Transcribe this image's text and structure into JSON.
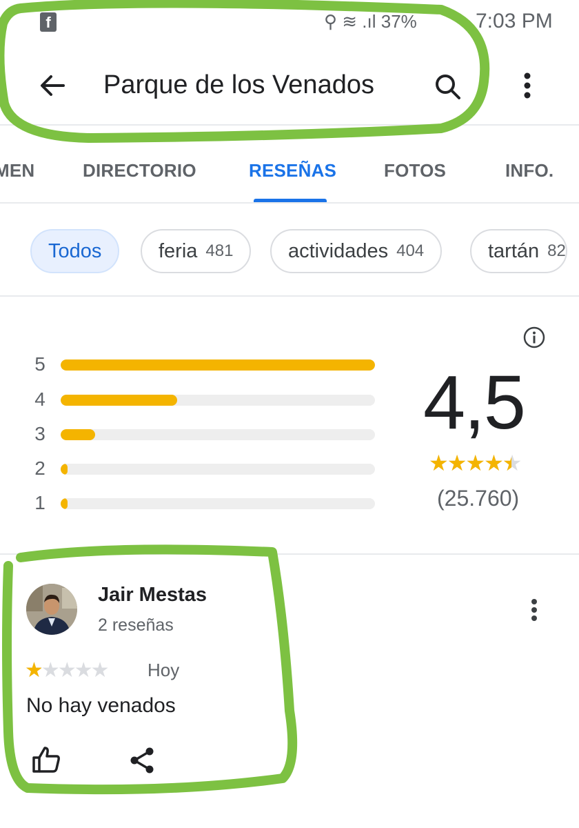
{
  "status_bar": {
    "notification_icon": "facebook-icon",
    "icons": "⚲ ≋ .ıl",
    "battery": "37%",
    "time": "7:03 PM"
  },
  "header": {
    "title": "Parque de los Venados",
    "back_icon": "arrow-back-icon",
    "search_icon": "search-icon",
    "more_icon": "more-vert-icon"
  },
  "tabs": [
    {
      "label": "MEN",
      "active": false
    },
    {
      "label": "DIRECTORIO",
      "active": false
    },
    {
      "label": "RESEÑAS",
      "active": true
    },
    {
      "label": "FOTOS",
      "active": false
    },
    {
      "label": "INFO.",
      "active": false
    }
  ],
  "chips": [
    {
      "label": "Todos",
      "count": "",
      "selected": true
    },
    {
      "label": "feria",
      "count": "481",
      "selected": false
    },
    {
      "label": "actividades",
      "count": "404",
      "selected": false
    },
    {
      "label": "tartán",
      "count": "82",
      "selected": false
    }
  ],
  "rating_summary": {
    "distribution": [
      {
        "stars": "5",
        "fraction": 1.0
      },
      {
        "stars": "4",
        "fraction": 0.37
      },
      {
        "stars": "3",
        "fraction": 0.11
      },
      {
        "stars": "2",
        "fraction": 0.02
      },
      {
        "stars": "1",
        "fraction": 0.02
      }
    ],
    "average": "4,5",
    "average_stars": 4.5,
    "total_reviews": "(25.760)",
    "info_icon": "info-icon"
  },
  "review": {
    "author": "Jair Mestas",
    "author_meta": "2 reseñas",
    "rating": 1,
    "date": "Hoy",
    "text": "No hay venados",
    "like_icon": "thumb-up-icon",
    "share_icon": "share-icon",
    "more_icon": "more-vert-icon"
  },
  "colors": {
    "accent": "#1a73e8",
    "star": "#f4b400",
    "marker": "#7dc142"
  }
}
